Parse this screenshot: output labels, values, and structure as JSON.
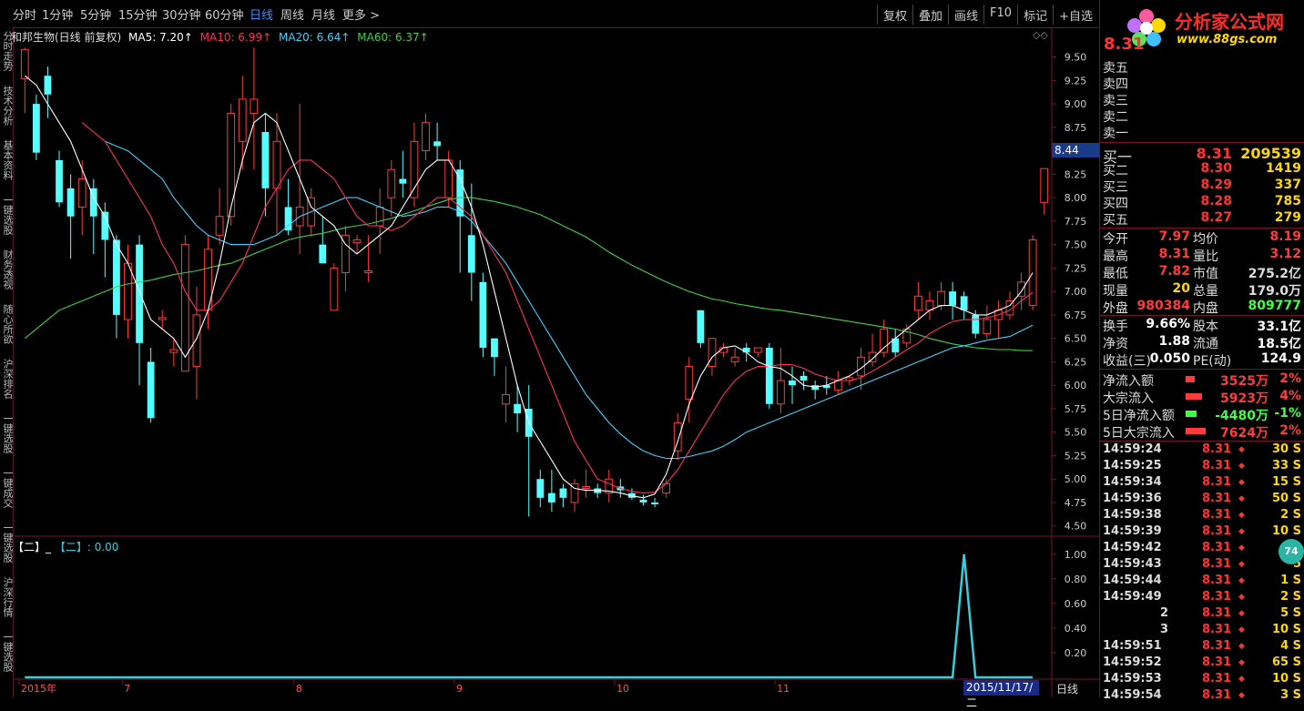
{
  "toolbar": {
    "tabs": [
      "分时",
      "1分钟",
      "5分钟",
      "15分钟",
      "30分钟",
      "60分钟",
      "日线",
      "周线",
      "月线",
      "更多 >"
    ],
    "active_tab": "日线",
    "right_buttons": [
      "复权",
      "叠加",
      "画线",
      "F10",
      "标记",
      "+自选"
    ]
  },
  "left_strip": [
    "分时走势",
    "技术分析",
    "基本资料",
    "一键选股",
    "财务透视",
    "随心所欲",
    "沪深排名",
    "一键选股",
    "一键成交",
    "一键选股",
    "沪深行情",
    "一键选股"
  ],
  "legend": {
    "stock": "和邦生物(日线 前复权)",
    "ma5": "MA5: 7.20↑",
    "ma10": "MA10: 6.99↑",
    "ma20": "MA20: 6.64↑",
    "ma60": "MA60: 6.37↑"
  },
  "indicator_legend": {
    "a": "【二】_",
    "b": "【二】: 0.00"
  },
  "current_price_tag": "8.44",
  "date_box": "2015/11/17/二",
  "period_label": "日线",
  "bubble": "74",
  "colors": {
    "up": "#ff3b3b",
    "down": "#54ffff",
    "ma5": "#ffffff",
    "ma10": "#ff3060",
    "ma20": "#40d0ff",
    "ma60": "#40d040",
    "indicator": "#30d0e0"
  },
  "chart_data": [
    {
      "type": "candlestick",
      "title": "和邦生物(日线 前复权)",
      "y_ticks": [
        "9.50",
        "9.25",
        "9.00",
        "8.75",
        "8.50",
        "8.25",
        "8.00",
        "7.75",
        "7.50",
        "7.25",
        "7.00",
        "6.75",
        "6.50",
        "6.25",
        "6.00",
        "5.75",
        "5.50",
        "5.25",
        "5.00",
        "4.75",
        "4.50"
      ],
      "ylim": [
        4.4,
        9.7
      ],
      "x_labels": [
        {
          "label": "2015年",
          "index": 0
        },
        {
          "label": "7",
          "index": 9
        },
        {
          "label": "8",
          "index": 24
        },
        {
          "label": "9",
          "index": 38
        },
        {
          "label": "10",
          "index": 52
        },
        {
          "label": "11",
          "index": 66
        }
      ],
      "candles": [
        [
          9.27,
          9.58,
          9.6,
          8.9
        ],
        [
          9.0,
          8.48,
          9.1,
          8.4
        ],
        [
          9.3,
          9.1,
          9.4,
          8.85
        ],
        [
          8.4,
          7.95,
          8.5,
          7.9
        ],
        [
          8.1,
          7.8,
          8.25,
          7.35
        ],
        [
          7.9,
          8.2,
          8.4,
          7.6
        ],
        [
          8.1,
          7.8,
          8.2,
          7.4
        ],
        [
          7.85,
          7.55,
          7.95,
          7.15
        ],
        [
          7.55,
          6.75,
          7.6,
          6.5
        ],
        [
          6.7,
          7.3,
          7.5,
          6.5
        ],
        [
          7.5,
          6.45,
          7.6,
          6.0
        ],
        [
          6.25,
          5.65,
          6.4,
          5.6
        ],
        [
          6.7,
          6.72,
          6.8,
          6.6
        ],
        [
          6.35,
          6.38,
          6.5,
          6.2
        ],
        [
          6.15,
          7.5,
          7.6,
          6.15
        ],
        [
          6.2,
          6.75,
          7.05,
          5.85
        ],
        [
          6.8,
          7.45,
          7.6,
          6.6
        ],
        [
          7.6,
          7.8,
          8.1,
          7.5
        ],
        [
          7.8,
          8.9,
          9.0,
          7.7
        ],
        [
          8.6,
          9.05,
          9.3,
          8.3
        ],
        [
          8.9,
          9.05,
          9.6,
          8.3
        ],
        [
          8.7,
          8.1,
          8.9,
          7.8
        ],
        [
          8.1,
          8.6,
          8.9,
          7.6
        ],
        [
          7.9,
          7.65,
          8.2,
          7.6
        ],
        [
          7.7,
          7.9,
          9.0,
          7.4
        ],
        [
          7.7,
          8.0,
          8.1,
          7.6
        ],
        [
          7.5,
          7.3,
          7.8,
          7.3
        ],
        [
          6.8,
          7.25,
          7.3,
          6.8
        ],
        [
          7.2,
          7.6,
          7.7,
          7.0
        ],
        [
          7.52,
          7.55,
          7.6,
          7.4
        ],
        [
          7.2,
          7.22,
          7.6,
          7.1
        ],
        [
          7.7,
          7.9,
          8.1,
          7.4
        ],
        [
          8.0,
          8.3,
          8.4,
          7.8
        ],
        [
          8.2,
          8.15,
          8.5,
          8.0
        ],
        [
          8.0,
          8.6,
          8.8,
          7.9
        ],
        [
          8.5,
          8.8,
          8.9,
          8.4
        ],
        [
          8.6,
          8.55,
          8.8,
          8.4
        ],
        [
          8.0,
          8.4,
          8.5,
          7.9
        ],
        [
          8.3,
          7.8,
          8.4,
          7.2
        ],
        [
          7.6,
          7.2,
          8.15,
          6.9
        ],
        [
          7.1,
          6.4,
          7.2,
          6.3
        ],
        [
          6.5,
          6.3,
          6.5,
          6.1
        ],
        [
          5.8,
          5.9,
          6.2,
          5.6
        ],
        [
          5.8,
          5.7,
          6.0,
          5.5
        ],
        [
          5.75,
          5.45,
          6.0,
          4.6
        ],
        [
          5.0,
          4.8,
          5.1,
          4.7
        ],
        [
          4.85,
          4.75,
          5.1,
          4.65
        ],
        [
          4.9,
          4.8,
          4.95,
          4.7
        ],
        [
          4.75,
          4.95,
          5.0,
          4.65
        ],
        [
          4.9,
          4.92,
          5.1,
          4.8
        ],
        [
          4.9,
          4.85,
          4.95,
          4.8
        ],
        [
          4.85,
          5.0,
          5.1,
          4.75
        ],
        [
          4.92,
          4.88,
          5.0,
          4.8
        ],
        [
          4.85,
          4.8,
          4.9,
          4.78
        ],
        [
          4.78,
          4.75,
          4.83,
          4.72
        ],
        [
          4.75,
          4.73,
          4.8,
          4.7
        ],
        [
          4.85,
          4.95,
          5.0,
          4.8
        ],
        [
          5.3,
          5.6,
          5.7,
          5.2
        ],
        [
          5.85,
          6.2,
          6.3,
          5.6
        ],
        [
          6.8,
          6.45,
          6.8,
          6.4
        ],
        [
          6.2,
          6.5,
          6.5,
          6.1
        ],
        [
          6.35,
          6.4,
          6.45,
          6.3
        ],
        [
          6.25,
          6.3,
          6.4,
          6.2
        ],
        [
          6.4,
          6.35,
          6.45,
          6.25
        ],
        [
          6.35,
          6.4,
          6.4,
          6.3
        ],
        [
          6.4,
          5.8,
          6.45,
          5.75
        ],
        [
          5.8,
          6.05,
          6.4,
          5.7
        ],
        [
          6.05,
          6.0,
          6.2,
          5.8
        ],
        [
          6.1,
          6.05,
          6.15,
          5.95
        ],
        [
          6.0,
          5.95,
          6.05,
          5.85
        ],
        [
          6.0,
          5.97,
          6.1,
          5.9
        ],
        [
          5.95,
          6.05,
          6.15,
          5.9
        ],
        [
          6.05,
          6.08,
          6.1,
          6.0
        ],
        [
          6.1,
          6.3,
          6.4,
          5.95
        ],
        [
          6.25,
          6.35,
          6.55,
          6.2
        ],
        [
          6.35,
          6.6,
          6.7,
          6.3
        ],
        [
          6.5,
          6.35,
          6.6,
          6.3
        ],
        [
          6.45,
          6.6,
          6.65,
          6.4
        ],
        [
          6.8,
          6.95,
          7.1,
          6.7
        ],
        [
          6.8,
          6.9,
          7.0,
          6.7
        ],
        [
          6.85,
          7.0,
          7.1,
          6.8
        ],
        [
          7.0,
          6.85,
          7.1,
          6.7
        ],
        [
          6.95,
          6.8,
          7.0,
          6.7
        ],
        [
          6.75,
          6.55,
          6.8,
          6.5
        ],
        [
          6.55,
          6.7,
          6.85,
          6.5
        ],
        [
          6.7,
          6.8,
          6.9,
          6.5
        ],
        [
          6.75,
          6.9,
          7.0,
          6.7
        ],
        [
          6.95,
          7.1,
          7.2,
          6.8
        ],
        [
          6.85,
          7.55,
          7.6,
          6.8
        ],
        [
          7.95,
          8.31,
          8.31,
          7.82
        ]
      ],
      "ma5": [
        9.3,
        9.2,
        9.0,
        8.8,
        8.6,
        8.3,
        8.0,
        7.8,
        7.5,
        7.3,
        7.0,
        6.7,
        6.6,
        6.5,
        6.3,
        6.5,
        6.8,
        7.3,
        7.9,
        8.4,
        8.8,
        8.9,
        8.8,
        8.5,
        8.2,
        7.9,
        7.8,
        7.7,
        7.5,
        7.4,
        7.5,
        7.6,
        7.7,
        7.9,
        8.1,
        8.3,
        8.4,
        8.4,
        8.2,
        7.9,
        7.5,
        7.0,
        6.5,
        6.0,
        5.6,
        5.4,
        5.2,
        5.0,
        4.9,
        4.88,
        4.88,
        4.87,
        4.85,
        4.82,
        4.8,
        4.84,
        5.05,
        5.4,
        5.8,
        6.1,
        6.3,
        6.4,
        6.42,
        6.35,
        6.25,
        6.2,
        6.18,
        6.1,
        6.0,
        5.98,
        6.0,
        6.05,
        6.1,
        6.18,
        6.28,
        6.4,
        6.5,
        6.6,
        6.7,
        6.8,
        6.85,
        6.85,
        6.8,
        6.75,
        6.75,
        6.8,
        6.85,
        7.0,
        7.2
      ],
      "ma10": [
        null,
        null,
        null,
        null,
        null,
        8.8,
        8.7,
        8.6,
        8.4,
        8.2,
        8.0,
        7.8,
        7.5,
        7.3,
        7.0,
        6.8,
        6.8,
        6.9,
        7.1,
        7.3,
        7.6,
        7.9,
        8.1,
        8.3,
        8.4,
        8.4,
        8.3,
        8.2,
        8.0,
        7.8,
        7.7,
        7.7,
        7.65,
        7.7,
        7.8,
        7.9,
        8.0,
        8.0,
        7.9,
        7.8,
        7.6,
        7.4,
        7.2,
        6.9,
        6.6,
        6.3,
        6.0,
        5.7,
        5.4,
        5.2,
        5.0,
        4.95,
        4.9,
        4.87,
        4.85,
        4.86,
        4.95,
        5.1,
        5.3,
        5.5,
        5.7,
        5.9,
        6.05,
        6.15,
        6.2,
        6.2,
        6.22,
        6.22,
        6.18,
        6.12,
        6.08,
        6.05,
        6.05,
        6.08,
        6.15,
        6.22,
        6.3,
        6.38,
        6.45,
        6.55,
        6.62,
        6.68,
        6.7,
        6.7,
        6.72,
        6.75,
        6.8,
        6.9,
        6.99
      ],
      "ma20": [
        null,
        null,
        null,
        null,
        null,
        null,
        null,
        8.6,
        8.55,
        8.5,
        8.4,
        8.3,
        8.2,
        8.0,
        7.85,
        7.7,
        7.6,
        7.55,
        7.5,
        7.5,
        7.5,
        7.55,
        7.6,
        7.7,
        7.8,
        7.85,
        7.9,
        7.95,
        8.0,
        8.0,
        7.95,
        7.9,
        7.85,
        7.8,
        7.82,
        7.85,
        7.9,
        7.9,
        7.85,
        7.75,
        7.6,
        7.45,
        7.3,
        7.1,
        6.9,
        6.7,
        6.5,
        6.3,
        6.1,
        5.9,
        5.75,
        5.6,
        5.48,
        5.38,
        5.3,
        5.25,
        5.22,
        5.22,
        5.24,
        5.27,
        5.3,
        5.35,
        5.42,
        5.5,
        5.55,
        5.6,
        5.65,
        5.7,
        5.75,
        5.8,
        5.85,
        5.9,
        5.95,
        6.0,
        6.05,
        6.1,
        6.15,
        6.2,
        6.25,
        6.3,
        6.35,
        6.4,
        6.42,
        6.45,
        6.48,
        6.5,
        6.52,
        6.58,
        6.64
      ],
      "ma60": [
        6.5,
        6.6,
        6.7,
        6.8,
        6.85,
        6.9,
        6.95,
        7.0,
        7.05,
        7.08,
        7.1,
        7.12,
        7.15,
        7.18,
        7.2,
        7.22,
        7.25,
        7.28,
        7.3,
        7.35,
        7.4,
        7.45,
        7.5,
        7.55,
        7.58,
        7.6,
        7.62,
        7.65,
        7.68,
        7.7,
        7.72,
        7.75,
        7.78,
        7.82,
        7.86,
        7.9,
        7.94,
        7.98,
        8.0,
        8.0,
        7.98,
        7.96,
        7.93,
        7.9,
        7.86,
        7.82,
        7.76,
        7.7,
        7.64,
        7.58,
        7.5,
        7.42,
        7.35,
        7.28,
        7.22,
        7.16,
        7.1,
        7.05,
        7.0,
        6.96,
        6.92,
        6.9,
        6.87,
        6.85,
        6.83,
        6.81,
        6.8,
        6.78,
        6.76,
        6.74,
        6.72,
        6.7,
        6.68,
        6.66,
        6.64,
        6.62,
        6.6,
        6.57,
        6.54,
        6.5,
        6.47,
        6.44,
        6.42,
        6.4,
        6.39,
        6.38,
        6.38,
        6.37,
        6.37
      ]
    },
    {
      "type": "line",
      "title": "【二】",
      "y_ticks": [
        "1.00",
        "0.80",
        "0.60",
        "0.40",
        "0.20"
      ],
      "ylim": [
        0,
        1.05
      ],
      "values_nonzero": [
        {
          "index": 82,
          "value": 1.0
        }
      ],
      "count": 89
    }
  ],
  "panel": {
    "price_big": "8.31",
    "asks": [
      "卖五",
      "卖四",
      "卖三",
      "卖二",
      "卖一"
    ],
    "bids": [
      {
        "label": "买一",
        "price": "8.31",
        "vol": "209539"
      },
      {
        "label": "买二",
        "price": "8.30",
        "vol": "1419"
      },
      {
        "label": "买三",
        "price": "8.29",
        "vol": "337"
      },
      {
        "label": "买四",
        "price": "8.28",
        "vol": "785"
      },
      {
        "label": "买五",
        "price": "8.27",
        "vol": "279"
      }
    ],
    "stats": [
      {
        "l1": "今开",
        "v1": "7.97",
        "c1": "#ff3b3b",
        "l2": "均价",
        "v2": "8.19",
        "c2": "#ff3b3b"
      },
      {
        "l1": "最高",
        "v1": "8.31",
        "c1": "#ff3b3b",
        "l2": "量比",
        "v2": "3.12",
        "c2": "#ff3b3b"
      },
      {
        "l1": "最低",
        "v1": "7.82",
        "c1": "#ff3b3b",
        "l2": "市值",
        "v2": "275.2亿",
        "c2": "#dddddd"
      },
      {
        "l1": "现量",
        "v1": "20",
        "c1": "#ffd800",
        "l2": "总量",
        "v2": "179.0万",
        "c2": "#dddddd"
      },
      {
        "l1": "外盘",
        "v1": "980384",
        "c1": "#ff3b3b",
        "l2": "内盘",
        "v2": "809777",
        "c2": "#40ff40"
      }
    ],
    "stats2": [
      {
        "l1": "换手",
        "v1": "9.66%",
        "l2": "股本",
        "v2": "33.1亿"
      },
      {
        "l1": "净资",
        "v1": "1.88",
        "l2": "流通",
        "v2": "18.5亿"
      },
      {
        "l1": "收益(三)",
        "v1": "0.050",
        "l2": "PE(动)",
        "v2": "124.9"
      }
    ],
    "flows": [
      {
        "label": "净流入额",
        "value": "3525万",
        "pct": "2%",
        "color": "#ff3b3b",
        "bar": 0.25,
        "neg": false
      },
      {
        "label": "大宗流入",
        "value": "5923万",
        "pct": "4%",
        "color": "#ff3b3b",
        "bar": 0.45,
        "neg": false
      },
      {
        "label": "5日净流入额",
        "value": "-4480万",
        "pct": "-1%",
        "color": "#40ff40",
        "bar": 0.3,
        "neg": true
      },
      {
        "label": "5日大宗流入",
        "value": "7624万",
        "pct": "2%",
        "color": "#ff3b3b",
        "bar": 0.55,
        "neg": false
      }
    ],
    "ticks": [
      {
        "t": "14:59:24",
        "p": "8.31",
        "v": "30 S"
      },
      {
        "t": "14:59:25",
        "p": "8.31",
        "v": "33 S"
      },
      {
        "t": "14:59:34",
        "p": "8.31",
        "v": "15 S"
      },
      {
        "t": "14:59:36",
        "p": "8.31",
        "v": "50 S"
      },
      {
        "t": "14:59:38",
        "p": "8.31",
        "v": "2 S"
      },
      {
        "t": "14:59:39",
        "p": "8.31",
        "v": "10 S"
      },
      {
        "t": "14:59:42",
        "p": "8.31",
        "v": "30"
      },
      {
        "t": "14:59:43",
        "p": "8.31",
        "v": "5"
      },
      {
        "t": "14:59:44",
        "p": "8.31",
        "v": "1 S"
      },
      {
        "t": "14:59:49",
        "p": "8.31",
        "v": "2 S"
      },
      {
        "t": "2",
        "p": "8.31",
        "v": "5 S"
      },
      {
        "t": "3",
        "p": "8.31",
        "v": "10 S"
      },
      {
        "t": "14:59:51",
        "p": "8.31",
        "v": "4 S"
      },
      {
        "t": "14:59:52",
        "p": "8.31",
        "v": "65 S"
      },
      {
        "t": "14:59:53",
        "p": "8.31",
        "v": "10 S"
      },
      {
        "t": "14:59:54",
        "p": "8.31",
        "v": "3 S"
      }
    ]
  },
  "logo": {
    "brand": "分析家公式网",
    "url": "www.88gs.com"
  }
}
